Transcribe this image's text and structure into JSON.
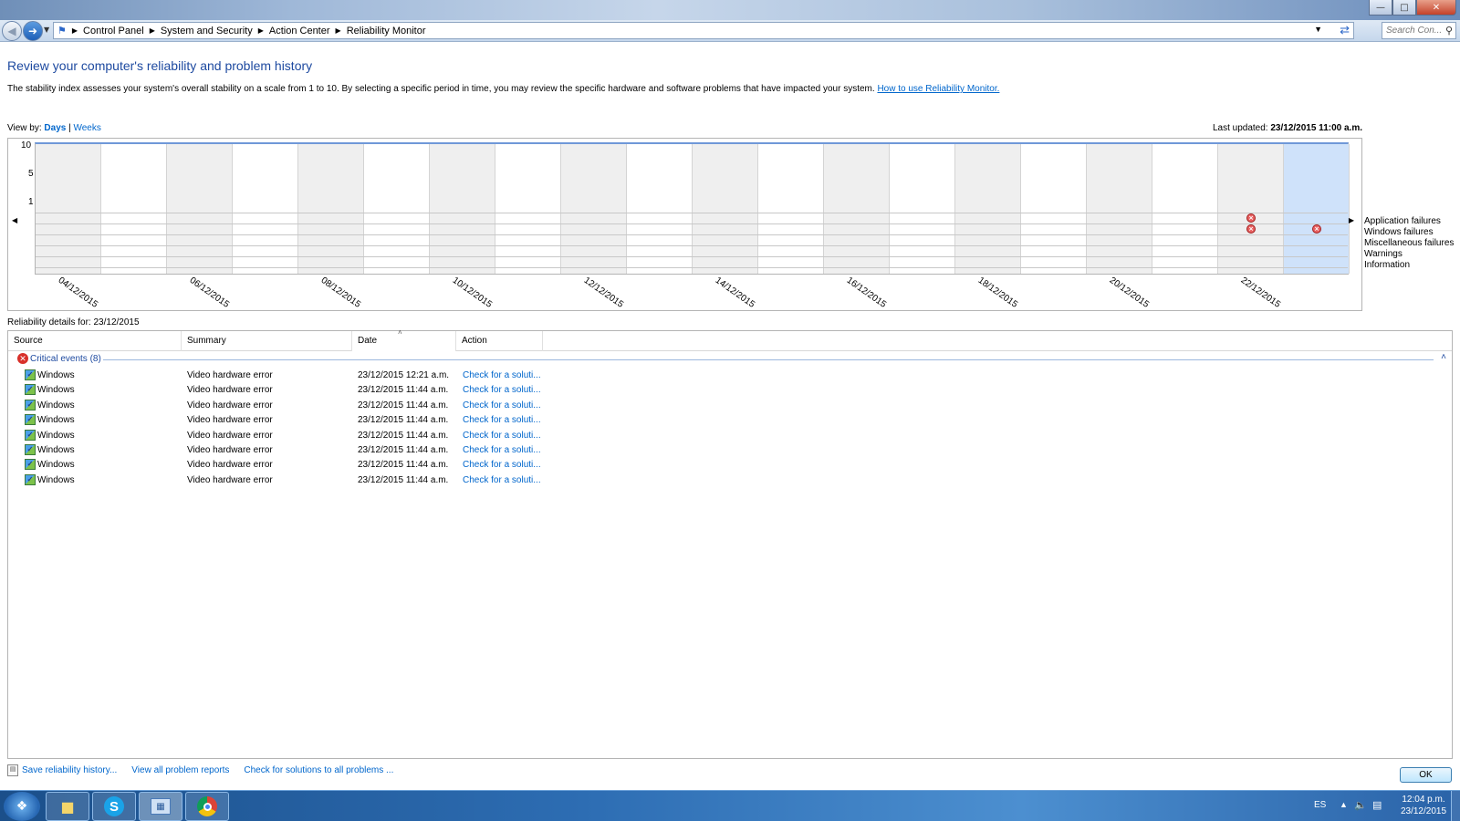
{
  "window": {
    "minimize_icon": "minimize-icon",
    "maximize_icon": "maximize-icon",
    "close_icon": "close-icon"
  },
  "address": {
    "breadcrumbs": [
      "Control Panel",
      "System and Security",
      "Action Center",
      "Reliability Monitor"
    ],
    "search_placeholder": "Search Con..."
  },
  "page": {
    "title": "Review your computer's reliability and problem history",
    "description": "The stability index assesses your system's overall stability on a scale from 1 to 10. By selecting a specific period in time, you may review the specific hardware and software problems that have impacted your system.",
    "help_link": "How to use Reliability Monitor."
  },
  "view": {
    "label": "View by:",
    "days": "Days",
    "separator": "|",
    "weeks": "Weeks",
    "last_updated_label": "Last updated:",
    "last_updated_value": "23/12/2015 11:00 a.m."
  },
  "chart_data": {
    "type": "table",
    "y_ticks": [
      "10",
      "5",
      "1"
    ],
    "x_labels": [
      "04/12/2015",
      "06/12/2015",
      "08/12/2015",
      "10/12/2015",
      "12/12/2015",
      "14/12/2015",
      "16/12/2015",
      "18/12/2015",
      "20/12/2015",
      "22/12/2015"
    ],
    "row_legend": [
      "Application failures",
      "Windows failures",
      "Miscellaneous failures",
      "Warnings",
      "Information"
    ],
    "events": [
      {
        "date": "22/12/2015",
        "row": "Application failures"
      },
      {
        "date": "22/12/2015",
        "row": "Windows failures"
      },
      {
        "date": "23/12/2015",
        "row": "Windows failures"
      }
    ],
    "selected_date": "23/12/2015"
  },
  "details": {
    "label": "Reliability details for: 23/12/2015",
    "columns": [
      "Source",
      "Summary",
      "Date",
      "Action"
    ],
    "group_label": "Critical events (8)",
    "rows": [
      {
        "source": "Windows",
        "summary": "Video hardware error",
        "date": "23/12/2015 12:21 a.m.",
        "action": "Check for a soluti..."
      },
      {
        "source": "Windows",
        "summary": "Video hardware error",
        "date": "23/12/2015 11:44 a.m.",
        "action": "Check for a soluti..."
      },
      {
        "source": "Windows",
        "summary": "Video hardware error",
        "date": "23/12/2015 11:44 a.m.",
        "action": "Check for a soluti..."
      },
      {
        "source": "Windows",
        "summary": "Video hardware error",
        "date": "23/12/2015 11:44 a.m.",
        "action": "Check for a soluti..."
      },
      {
        "source": "Windows",
        "summary": "Video hardware error",
        "date": "23/12/2015 11:44 a.m.",
        "action": "Check for a soluti..."
      },
      {
        "source": "Windows",
        "summary": "Video hardware error",
        "date": "23/12/2015 11:44 a.m.",
        "action": "Check for a soluti..."
      },
      {
        "source": "Windows",
        "summary": "Video hardware error",
        "date": "23/12/2015 11:44 a.m.",
        "action": "Check for a soluti..."
      },
      {
        "source": "Windows",
        "summary": "Video hardware error",
        "date": "23/12/2015 11:44 a.m.",
        "action": "Check for a soluti..."
      }
    ]
  },
  "bottom": {
    "save_link": "Save reliability history...",
    "view_reports_link": "View all problem reports",
    "check_solutions_link": "Check for solutions to all problems ...",
    "ok_label": "OK"
  },
  "taskbar": {
    "lang": "ES",
    "time": "12:04 p.m.",
    "date": "23/12/2015",
    "skype_letter": "S"
  }
}
